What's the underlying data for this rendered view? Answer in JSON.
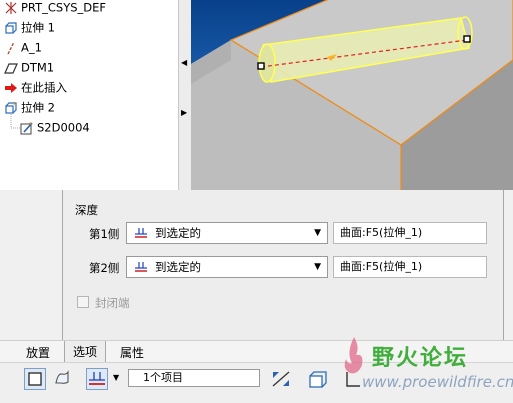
{
  "model_tree": {
    "items": [
      {
        "label": "PRT_CSYS_DEF",
        "icon": "csys-icon"
      },
      {
        "label": "拉伸 1",
        "icon": "extrude-icon"
      },
      {
        "label": "A_1",
        "icon": "axis-icon"
      },
      {
        "label": "DTM1",
        "icon": "datum-plane-icon"
      },
      {
        "label": "在此插入",
        "icon": "insert-here-arrow-icon"
      },
      {
        "label": "拉伸 2",
        "icon": "extrude-new-icon"
      },
      {
        "label": "S2D0004",
        "icon": "sketch-icon"
      }
    ]
  },
  "options_panel": {
    "depth_label": "深度",
    "side1": {
      "label": "第1侧",
      "mode": "到选定的",
      "reference": "曲面:F5(拉伸_1)"
    },
    "side2": {
      "label": "第2侧",
      "mode": "到选定的",
      "reference": "曲面:F5(拉伸_1)"
    },
    "capped_ends": {
      "label": "封闭端",
      "checked": false,
      "enabled": false
    }
  },
  "dashboard": {
    "tabs": [
      "放置",
      "选项",
      "属性"
    ],
    "active_tab": "选项",
    "reference_box": "1个项目"
  },
  "watermark": {
    "title": "野火论坛",
    "url": "www.proewildfire.cn"
  },
  "colors": {
    "viewport_top": "#08408a",
    "viewport_bottom": "#2e76c4",
    "selection": "#ffff66",
    "edge_highlight": "#f08a14"
  }
}
